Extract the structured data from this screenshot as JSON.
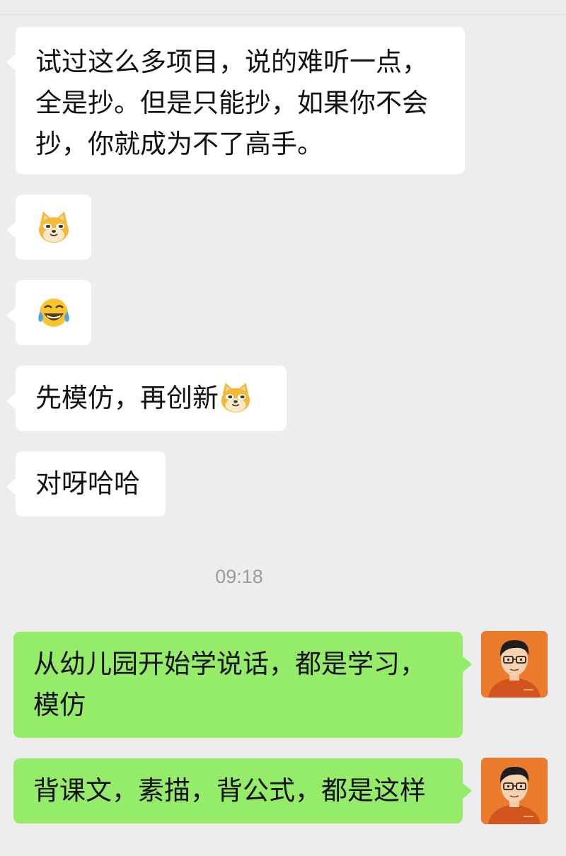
{
  "conversation": {
    "messages": [
      {
        "side": "left",
        "text": "试过这么多项目，说的难听一点，全是抄。但是只能抄，如果你不会抄，你就成为不了高手。",
        "lines": [
          "试过这么多项目，说的难听一点，",
          "全是抄。但是只能抄，如果你不会",
          "抄，你就成为不了高手。"
        ]
      },
      {
        "side": "left",
        "emoji": "doge-icon"
      },
      {
        "side": "left",
        "emoji": "tears-of-joy-icon"
      },
      {
        "side": "left",
        "text": "先模仿，再创新",
        "emoji": "doge-icon"
      },
      {
        "side": "left",
        "text": "对呀哈哈"
      },
      {
        "side": "right",
        "text": "从幼儿园开始学说话，都是学习，模仿",
        "lines": [
          "从幼儿园开始学说话，都是学习，",
          "模仿"
        ]
      },
      {
        "side": "right",
        "text": "背课文，素描，背公式，都是这样"
      }
    ],
    "timestamp": "09:18"
  },
  "colors": {
    "background": "#ededed",
    "incoming_bubble": "#ffffff",
    "outgoing_bubble": "#95ec69",
    "avatar_bg": "#ea7a2c",
    "timestamp": "#9b9b9b"
  }
}
